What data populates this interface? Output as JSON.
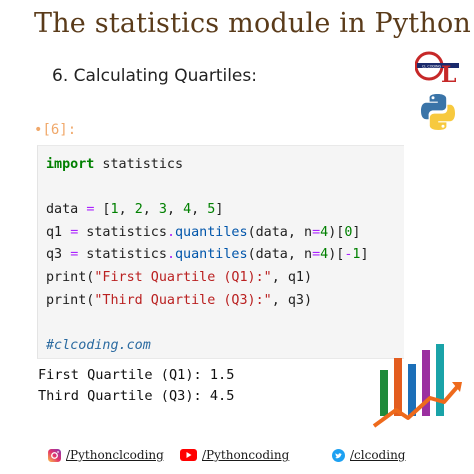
{
  "header": {
    "title": "The statistics module in Python",
    "subtitle": "6. Calculating Quartiles:"
  },
  "cell": {
    "prompt": "[6]:",
    "comment": "#clcoding.com"
  },
  "output": {
    "line1": "First Quartile (Q1): 1.5",
    "line2": "Third Quartile (Q3): 4.5"
  },
  "footer": {
    "instagram": "/Pythonclcoding",
    "youtube": "/Pythoncoding",
    "twitter": "/clcoding"
  },
  "brand": {
    "logo_text": "CL CODING"
  },
  "colors": {
    "title": "#5a3b1a",
    "prompt": "#f0a86a",
    "keyword": "#008000",
    "string": "#ba2121",
    "operator": "#aa22ff",
    "comment": "#2a6aa0"
  },
  "icons": [
    "clcoding-logo",
    "python-logo",
    "bar-chart-arrow-icon",
    "instagram-icon",
    "youtube-icon",
    "twitter-icon"
  ]
}
